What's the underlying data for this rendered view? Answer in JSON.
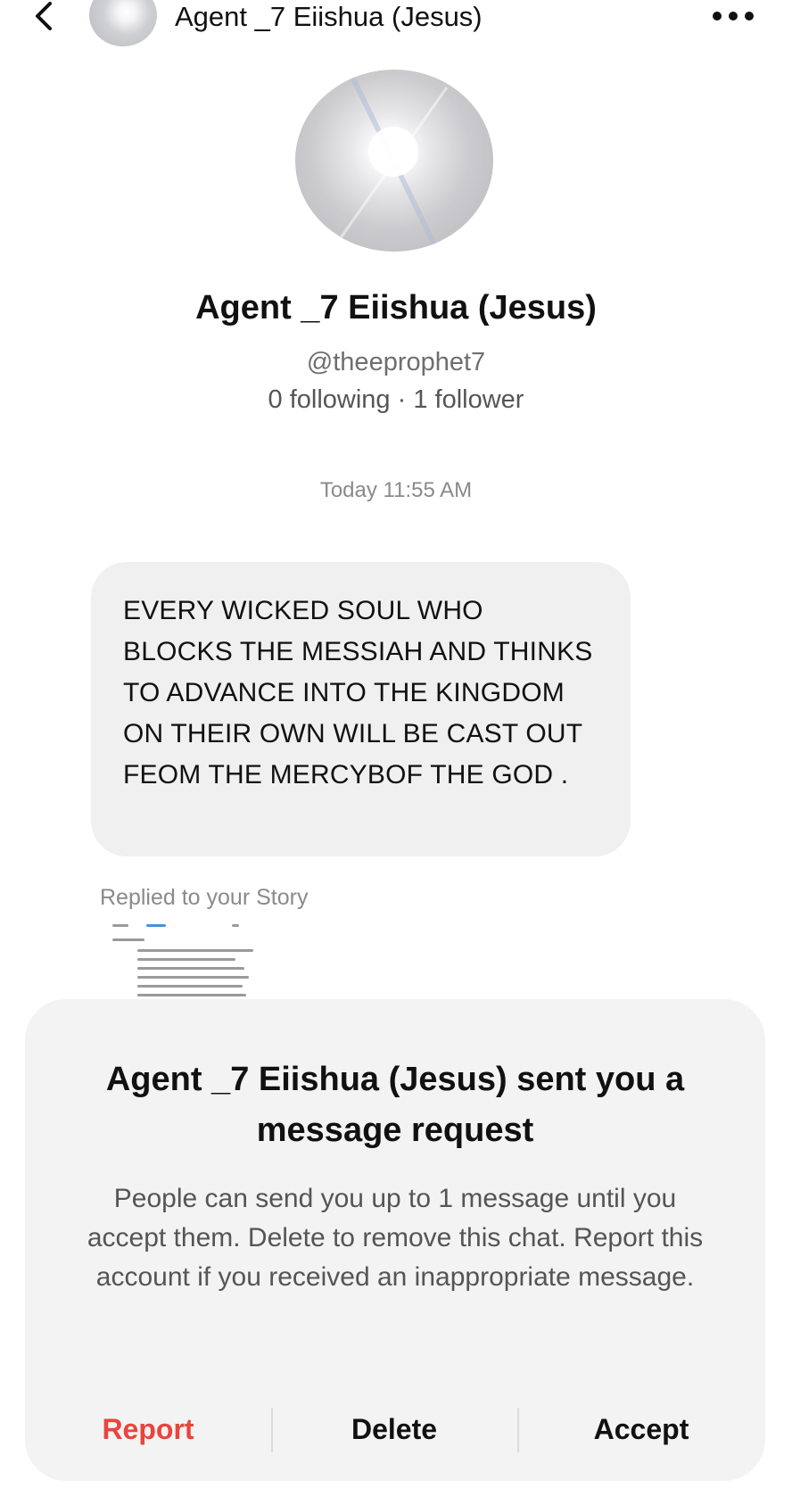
{
  "header": {
    "title": "Agent _7 Eiishua (Jesus)",
    "back_icon": "chevron-left-icon",
    "more_icon": "more-horizontal-icon"
  },
  "profile": {
    "name": "Agent _7 Eiishua (Jesus)",
    "handle": "@theeprophet7",
    "stats": "0 following · 1 follower"
  },
  "conversation": {
    "timestamp": "Today 11:55 AM",
    "message": "EVERY WICKED SOUL WHO BLOCKS THE MESSIAH AND THINKS TO ADVANCE INTO THE KINGDOM ON THEIR OWN WILL BE CAST OUT FEOM THE MERCYBOF THE GOD .",
    "replied_label": "Replied to your Story"
  },
  "request_sheet": {
    "title": "Agent _7 Eiishua (Jesus) sent you a message request",
    "body": "People can send you up to 1 message until you accept them. Delete to remove this chat. Report this account if you received an inappropriate message.",
    "actions": {
      "report": "Report",
      "delete": "Delete",
      "accept": "Accept"
    }
  },
  "colors": {
    "report": "#e8453c",
    "bubble": "#f0f0f0",
    "sheet": "#f3f3f3"
  }
}
